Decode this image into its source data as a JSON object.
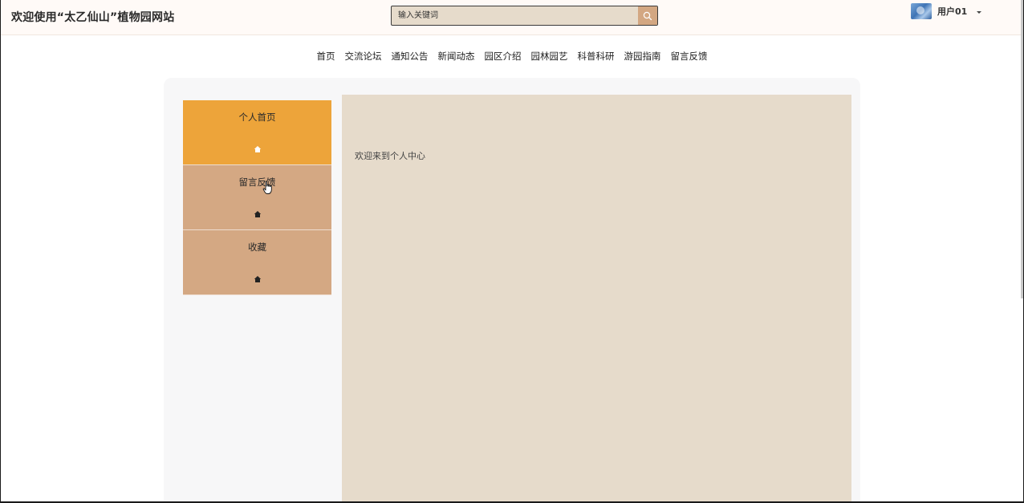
{
  "header": {
    "site_title": "欢迎使用“太乙仙山”植物园网站",
    "search": {
      "placeholder": "输入关键词",
      "button_icon": "search-icon"
    },
    "user": {
      "name": "用户01",
      "avatar_icon": "avatar-image",
      "menu_icon": "caret-down-icon"
    }
  },
  "nav": {
    "items": [
      "首页",
      "交流论坛",
      "通知公告",
      "新闻动态",
      "园区介绍",
      "园林园艺",
      "科普科研",
      "游园指南",
      "留言反馈"
    ]
  },
  "sidebar": {
    "items": [
      {
        "label": "个人首页",
        "icon": "home-icon",
        "active": true
      },
      {
        "label": "留言反馈",
        "icon": "home-icon",
        "active": false
      },
      {
        "label": "收藏",
        "icon": "home-icon",
        "active": false
      }
    ]
  },
  "main": {
    "welcome_text": "欢迎来到个人中心"
  },
  "colors": {
    "header_bg": "#fffaf7",
    "accent_tan": "#d4a883",
    "active_orange": "#eda43a",
    "content_bg": "#e6dbcb"
  }
}
